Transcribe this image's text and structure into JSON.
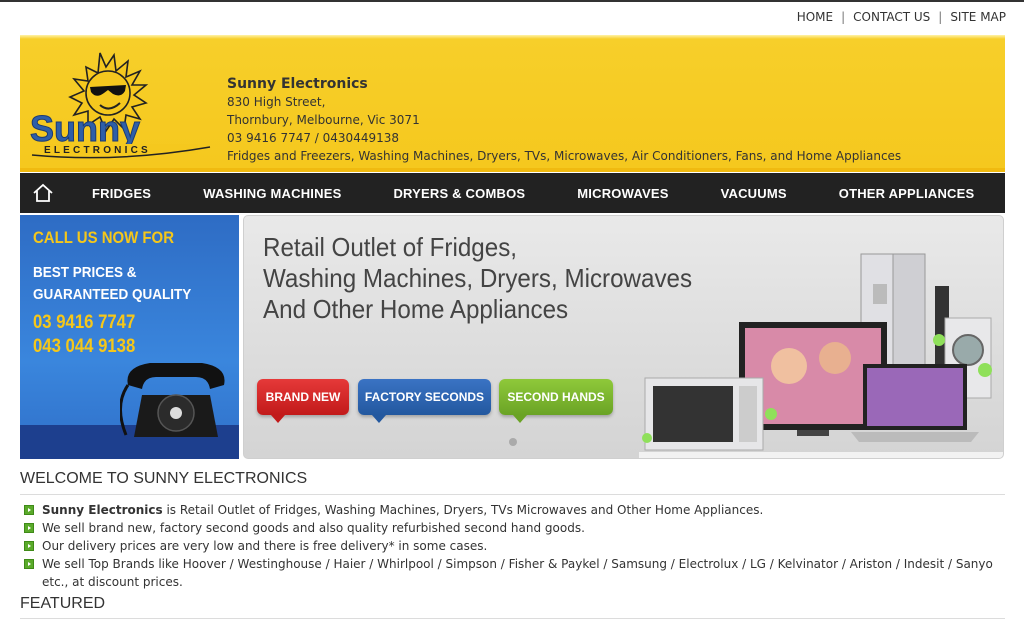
{
  "toplinks": {
    "home": "HOME",
    "contact": "CONTACT US",
    "sitemap": "SITE MAP",
    "separator": "|"
  },
  "header": {
    "name": "Sunny Electronics",
    "address1": "830 High Street,",
    "address2": "Thornbury, Melbourne, Vic 3071",
    "phones": "03 9416 7747 / 0430449138",
    "products": "Fridges and Freezers, Washing Machines, Dryers, TVs, Microwaves, Air Conditioners, Fans, and Home Appliances",
    "logo_text": "Sunny",
    "logo_sub": "ELECTRONICS"
  },
  "nav": {
    "home_icon": "home-icon",
    "items": [
      "FRIDGES",
      "WASHING MACHINES",
      "DRYERS & COMBOS",
      "MICROWAVES",
      "VACUUMS",
      "OTHER APPLIANCES"
    ]
  },
  "promo": {
    "line1": "CALL US NOW FOR",
    "line2": "BEST PRICES & GUARANTEED QUALITY",
    "phone1": "03 9416 7747",
    "phone2": "043 044 9138"
  },
  "banner": {
    "headline1": "Retail Outlet of Fridges,",
    "headline2": "Washing Machines, Dryers, Microwaves",
    "headline3": "And Other Home Appliances",
    "btn_new": "BRAND NEW",
    "btn_factory": "FACTORY SECONDS",
    "btn_second": "SECOND HANDS"
  },
  "welcome": {
    "title": "WELCOME TO SUNNY ELECTRONICS",
    "b1_bold": "Sunny Electronics",
    "b1_rest": " is Retail Outlet of Fridges, Washing Machines, Dryers, TVs Microwaves and Other Home Appliances.",
    "b2": "We sell brand new, factory second goods and also quality refurbished second hand goods.",
    "b3": "Our delivery prices are very low and there is free delivery* in some cases.",
    "b4": "We sell Top Brands like Hoover / Westinghouse / Haier / Whirlpool / Simpson / Fisher & Paykel / Samsung / Electrolux / LG / Kelvinator / Ariston / Indesit / Sanyo etc., at discount prices."
  },
  "featured": {
    "title": "FEATURED"
  },
  "colors": {
    "header_yellow": "#f5c81e",
    "nav_bg": "#222222",
    "promo_blue": "#3a86dd",
    "bullet_green": "#5aaa2a"
  }
}
